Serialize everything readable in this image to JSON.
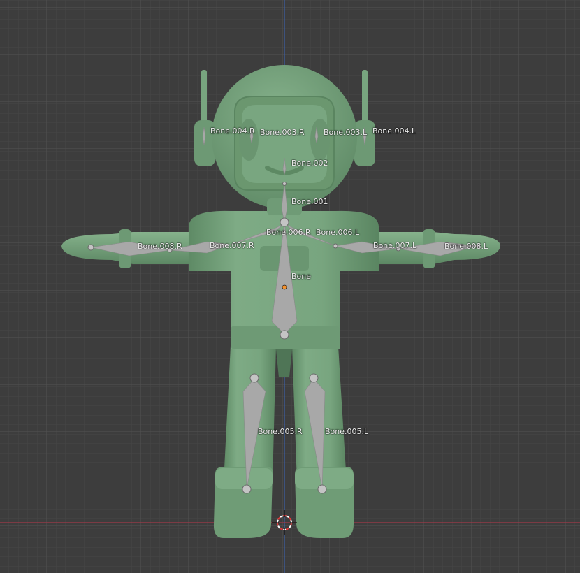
{
  "viewport": {
    "background": "#3d3d3d",
    "grid_minor": "#474747",
    "grid_major": "#555555",
    "axis_x_color": "#a33a4a",
    "axis_z_color": "#3e62a8",
    "model_color": "#78a57f",
    "bone_color": "#a8a8a8",
    "origin_color": "#f5922d"
  },
  "scene_objects": {
    "mesh": "character-mesh",
    "armature": "armature",
    "cursor_icon": "3d-cursor-icon",
    "origin_icon": "object-origin-icon"
  },
  "bones": {
    "bone_004_r": "Bone.004.R",
    "bone_003_r": "Bone.003.R",
    "bone_003_l": "Bone.003.L",
    "bone_004_l": "Bone.004.L",
    "bone_002": "Bone.002",
    "bone_001": "Bone.001",
    "bone_006_r": "Bone.006.R",
    "bone_006_l": "Bone.006.L",
    "bone_008_r": "Bone.008.R",
    "bone_007_r": "Bone.007.R",
    "bone_007_l": "Bone.007.L",
    "bone_008_l": "Bone.008.L",
    "bone": "Bone",
    "bone_005_r": "Bone.005.R",
    "bone_005_l": "Bone.005.L"
  }
}
